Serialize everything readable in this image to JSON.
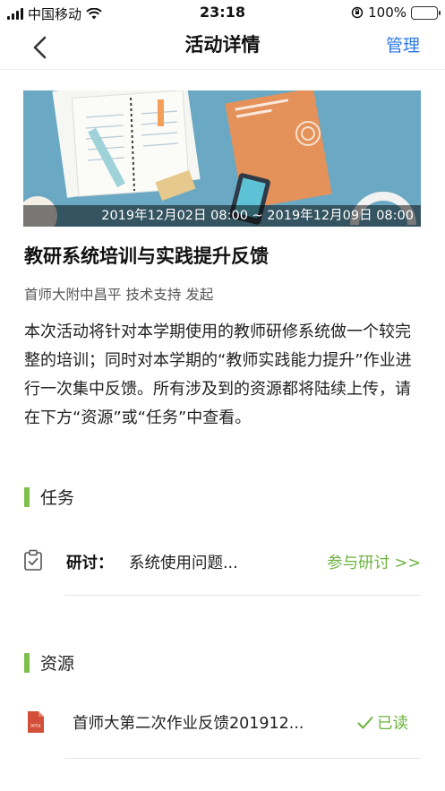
{
  "status_bar": {
    "carrier": "中国移动",
    "time": "23:18",
    "battery": "100%",
    "battery_level": 1.0
  },
  "nav": {
    "title": "活动详情",
    "manage_label": "管理",
    "back_icon": "chevron-left-icon"
  },
  "banner": {
    "date_range": "2019年12月02日 08:00 ~ 2019年12月09日 08:00"
  },
  "activity": {
    "title": "教研系统培训与实践提升反馈",
    "meta": "首师大附中昌平 技术支持 发起",
    "description": "本次活动将针对本学期使用的教师研修系统做一个较完整的培训；同时对本学期的“教师实践能力提升”作业进行一次集中反馈。所有涉及到的资源都将陆续上传，请在下方“资源”或“任务”中查看。"
  },
  "tasks": {
    "heading": "任务",
    "items": [
      {
        "type": "研讨：",
        "name": "系统使用问题...",
        "action": "参与研讨 >>",
        "icon": "clipboard-check-icon"
      }
    ]
  },
  "resources": {
    "heading": "资源",
    "items": [
      {
        "name": "首师大第二次作业反馈201912...",
        "status": "已读",
        "icon": "pptx-file-icon",
        "badge": "PPTX"
      }
    ]
  },
  "colors": {
    "accent_blue": "#2f7ae5",
    "accent_green": "#6db33f",
    "section_bar": "#7cbf4b"
  }
}
